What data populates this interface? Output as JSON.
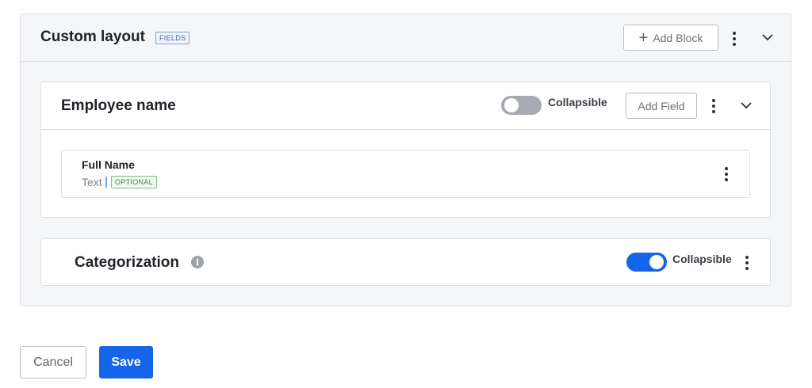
{
  "layout": {
    "title": "Custom layout",
    "tag": "FIELDS",
    "add_block_label": "Add Block"
  },
  "blocks": [
    {
      "title": "Employee name",
      "collapsible_label": "Collapsible",
      "collapsible_on": false,
      "add_field_label": "Add Field",
      "fields": [
        {
          "name": "Full Name",
          "type": "Text",
          "separator": "|",
          "tag": "OPTIONAL"
        }
      ]
    },
    {
      "title": "Categorization",
      "collapsible_label": "Collapsible",
      "collapsible_on": true
    }
  ],
  "footer": {
    "cancel_label": "Cancel",
    "save_label": "Save"
  },
  "colors": {
    "primary": "#1565e8",
    "toggle_off": "#a7abb1",
    "optional_tag": "#2f8a3a",
    "fields_tag": "#4a6fa5"
  },
  "icons": [
    "plus-icon",
    "kebab-menu-icon",
    "chevron-down-icon",
    "info-icon"
  ]
}
